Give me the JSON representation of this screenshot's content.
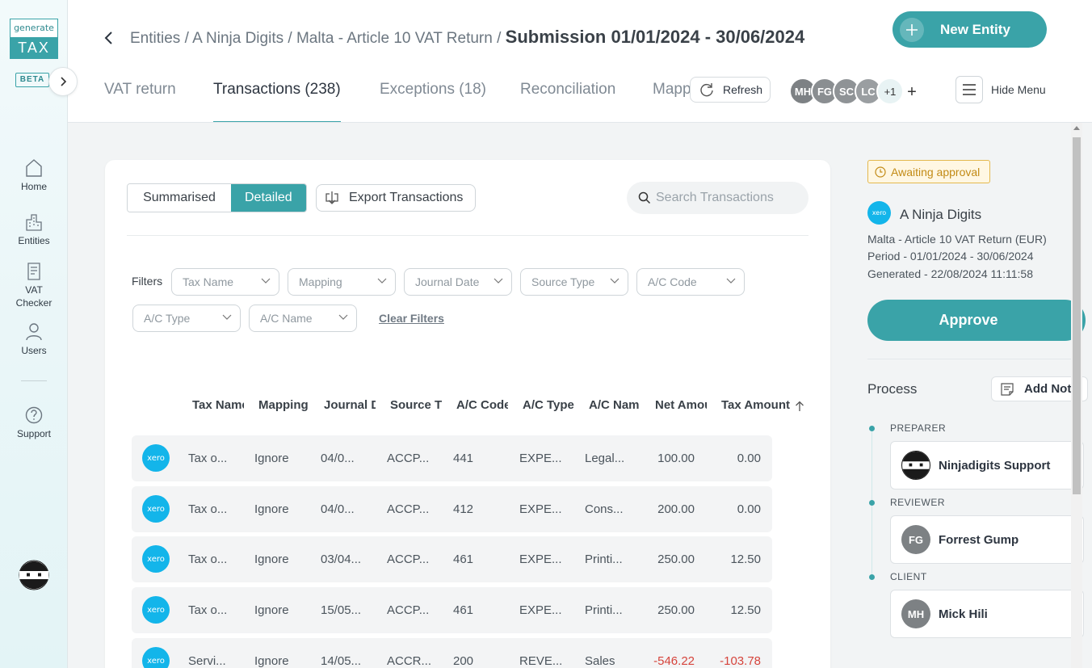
{
  "brand": {
    "logo_top": "generate",
    "logo_bottom": "TAX",
    "beta": "BETA"
  },
  "sidebar": {
    "items": [
      {
        "label": "Home",
        "icon": "home-icon"
      },
      {
        "label": "Entities",
        "icon": "buildings-icon"
      },
      {
        "label": "VAT Checker",
        "icon": "document-icon"
      },
      {
        "label": "Users",
        "icon": "user-icon"
      },
      {
        "label": "Support",
        "icon": "question-icon"
      }
    ]
  },
  "header": {
    "breadcrumb": [
      "Entities",
      "A Ninja Digits",
      "Malta - Article 10 VAT Return"
    ],
    "separator": "/",
    "current": "Submission 01/01/2024 - 30/06/2024",
    "new_entity": "New Entity",
    "refresh": "Refresh",
    "hide_menu": "Hide Menu",
    "avatars": [
      {
        "initials": "MH",
        "color": "#7d8184"
      },
      {
        "initials": "FG",
        "color": "#8a8e91"
      },
      {
        "initials": "SC",
        "color": "#8f9396"
      },
      {
        "initials": "LC",
        "color": "#9a9ea1"
      },
      {
        "initials": "+1",
        "color": "#e8f3f4"
      }
    ]
  },
  "tabs": [
    {
      "label": "VAT return",
      "active": false
    },
    {
      "label": "Transactions (238)",
      "active": true
    },
    {
      "label": "Exceptions (18)",
      "active": false
    },
    {
      "label": "Reconciliation",
      "active": false
    },
    {
      "label": "Mapp",
      "active": false
    }
  ],
  "toolbar": {
    "summarised": "Summarised",
    "detailed": "Detailed",
    "export": "Export Transactions",
    "search_placeholder": "Search Transactions"
  },
  "filters": {
    "label": "Filters",
    "items": [
      "Tax Name",
      "Mapping",
      "Journal Date",
      "Source Type",
      "A/C Code",
      "A/C Type",
      "A/C Name"
    ],
    "clear": "Clear Filters"
  },
  "table": {
    "columns": [
      "Tax Name",
      "Mapping",
      "Journal D",
      "Source T",
      "A/C Code",
      "A/C Type",
      "A/C Nam",
      "Net Amou",
      "Tax Amount"
    ],
    "rows": [
      {
        "source": "xero",
        "tax_name": "Tax o...",
        "mapping": "Ignore",
        "journal_date": "04/0...",
        "source_type": "ACCP...",
        "ac_code": "441",
        "ac_type": "EXPE...",
        "ac_name": "Legal...",
        "net": "100.00",
        "tax": "0.00",
        "negative": false
      },
      {
        "source": "xero",
        "tax_name": "Tax o...",
        "mapping": "Ignore",
        "journal_date": "04/0...",
        "source_type": "ACCP...",
        "ac_code": "412",
        "ac_type": "EXPE...",
        "ac_name": "Cons...",
        "net": "200.00",
        "tax": "0.00",
        "negative": false
      },
      {
        "source": "xero",
        "tax_name": "Tax o...",
        "mapping": "Ignore",
        "journal_date": "03/04...",
        "source_type": "ACCP...",
        "ac_code": "461",
        "ac_type": "EXPE...",
        "ac_name": "Printi...",
        "net": "250.00",
        "tax": "12.50",
        "negative": false
      },
      {
        "source": "xero",
        "tax_name": "Tax o...",
        "mapping": "Ignore",
        "journal_date": "15/05...",
        "source_type": "ACCP...",
        "ac_code": "461",
        "ac_type": "EXPE...",
        "ac_name": "Printi...",
        "net": "250.00",
        "tax": "12.50",
        "negative": false
      },
      {
        "source": "xero",
        "tax_name": "Servi...",
        "mapping": "Ignore",
        "journal_date": "14/05...",
        "source_type": "ACCR...",
        "ac_code": "200",
        "ac_type": "REVE...",
        "ac_name": "Sales",
        "net": "-546.22",
        "tax": "-103.78",
        "negative": true
      }
    ]
  },
  "panel": {
    "status": "Awaiting approval",
    "entity_logo": "xero",
    "entity_name": "A Ninja Digits",
    "return_name": "Malta - Article 10 VAT Return (EUR)",
    "period": "Period - 01/01/2024 - 30/06/2024",
    "generated": "Generated - 22/08/2024 11:11:58",
    "approve": "Approve",
    "process": "Process",
    "add_note": "Add Note",
    "roles": [
      {
        "role": "PREPARER",
        "name": "Ninjadigits Support",
        "initials": "",
        "avatar": "ninja"
      },
      {
        "role": "REVIEWER",
        "name": "Forrest Gump",
        "initials": "FG",
        "avatar": "initials"
      },
      {
        "role": "CLIENT",
        "name": "Mick Hili",
        "initials": "MH",
        "avatar": "initials"
      }
    ]
  },
  "colors": {
    "accent": "#3aa3a8",
    "xero": "#13b5ea",
    "negative": "#d6443c",
    "warning": "#c28a15"
  }
}
